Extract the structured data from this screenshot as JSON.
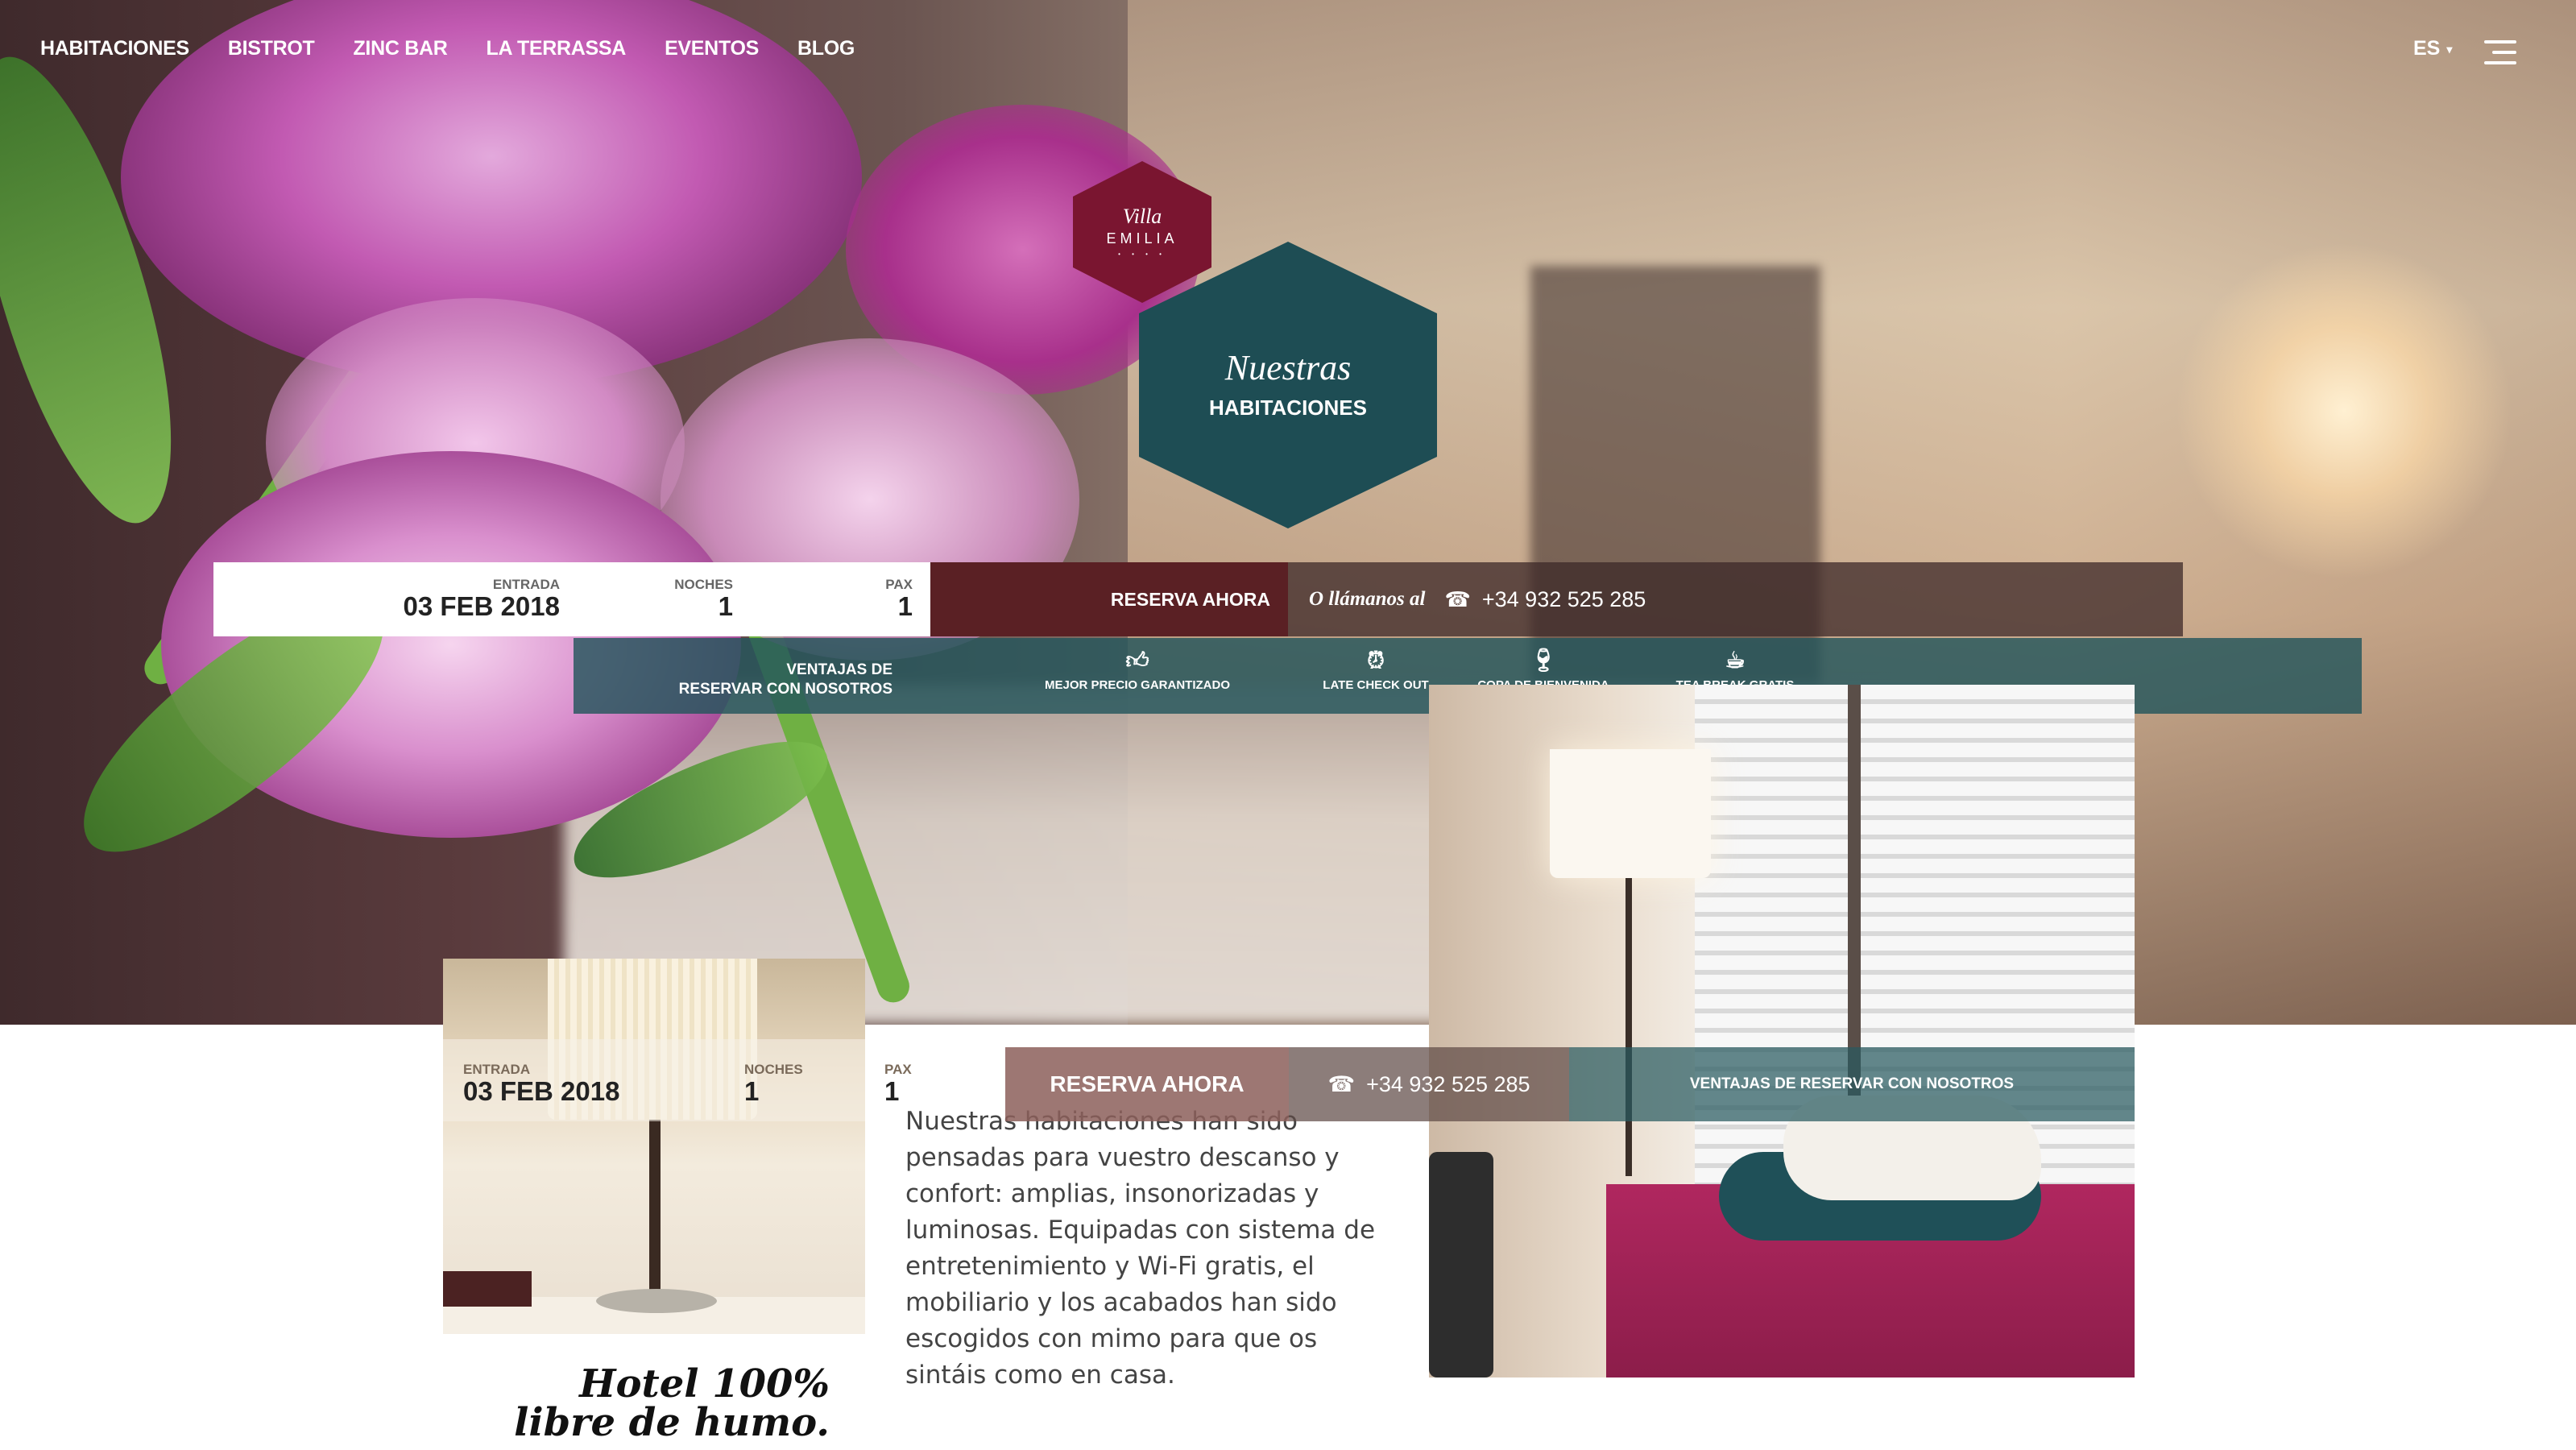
{
  "nav": {
    "links": [
      "HABITACIONES",
      "BISTROT",
      "ZINC BAR",
      "LA TERRASSA",
      "EVENTOS",
      "BLOG"
    ],
    "language": "ES"
  },
  "logo": {
    "line1": "Villa",
    "line2": "EMILIA",
    "stars": "• • • •"
  },
  "hero_title": {
    "script": "Nuestras",
    "caps": "HABITACIONES"
  },
  "booking": {
    "entrada_label": "ENTRADA",
    "entrada_value": "03 FEB 2018",
    "noches_label": "NOCHES",
    "noches_value": "1",
    "pax_label": "PAX",
    "pax_value": "1",
    "reserva_label": "RESERVA AHORA",
    "call_text": "O llámanos al",
    "phone": "+34 932 525 285"
  },
  "benefits": {
    "title_line1": "VENTAJAS DE",
    "title_line2": "RESERVAR CON NOSOTROS",
    "items": [
      {
        "label": "MEJOR PRECIO GARANTIZADO",
        "icon": "thumbs-up-icon"
      },
      {
        "label": "LATE CHECK OUT",
        "icon": "alarm-clock-icon"
      },
      {
        "label": "COPA DE BIENVENIDA",
        "icon": "wine-glass-icon"
      },
      {
        "label": "TEA BREAK GRATIS",
        "icon": "tea-cup-icon"
      }
    ]
  },
  "booking2": {
    "entrada_label": "ENTRADA",
    "entrada_value": "03 FEB 2018",
    "noches_label": "NOCHES",
    "noches_value": "1",
    "pax_label": "PAX",
    "pax_value": "1",
    "reserva_label": "RESERVA AHORA",
    "phone": "+34 932 525 285",
    "ventajas_label": "VENTAJAS DE RESERVAR CON NOSOTROS"
  },
  "content": {
    "description": "Nuestras habitaciones han sido pensadas para vuestro descanso y confort: amplias, insonorizadas y luminosas. Equipadas con sistema de entretenimiento y Wi-Fi gratis, el mobiliario y los acabados han sido escogidos con mimo para que os sintáis como en casa.",
    "smoke_line1": "Hotel 100%",
    "smoke_line2": "libre de humo."
  }
}
